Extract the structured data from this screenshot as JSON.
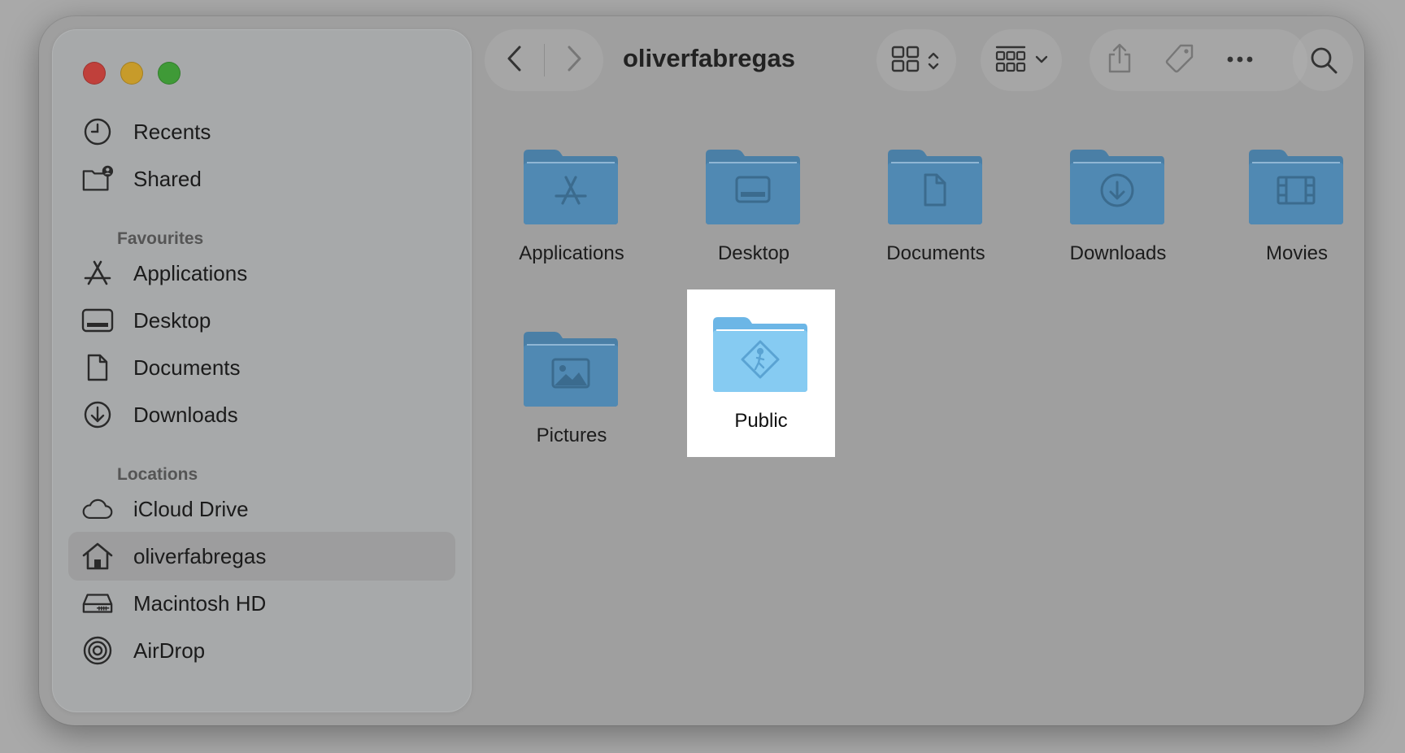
{
  "window": {
    "title": "oliverfabregas"
  },
  "sidebar": {
    "items_top": [
      {
        "label": "Recents",
        "icon": "clock-icon"
      },
      {
        "label": "Shared",
        "icon": "shared-folder-icon"
      }
    ],
    "favourites_heading": "Favourites",
    "favourites": [
      {
        "label": "Applications",
        "icon": "applications-icon"
      },
      {
        "label": "Desktop",
        "icon": "desktop-icon"
      },
      {
        "label": "Documents",
        "icon": "document-icon"
      },
      {
        "label": "Downloads",
        "icon": "download-icon"
      }
    ],
    "locations_heading": "Locations",
    "locations": [
      {
        "label": "iCloud Drive",
        "icon": "cloud-icon"
      },
      {
        "label": "oliverfabregas",
        "icon": "home-icon",
        "selected": true
      },
      {
        "label": "Macintosh HD",
        "icon": "drive-icon"
      },
      {
        "label": "AirDrop",
        "icon": "airdrop-icon"
      }
    ]
  },
  "files": [
    {
      "name": "Applications",
      "glyph": "applications-glyph"
    },
    {
      "name": "Desktop",
      "glyph": "desktop-glyph"
    },
    {
      "name": "Documents",
      "glyph": "document-glyph"
    },
    {
      "name": "Downloads",
      "glyph": "download-glyph"
    },
    {
      "name": "Movies",
      "glyph": "film-glyph"
    },
    {
      "name": "Pictures",
      "glyph": "picture-glyph"
    },
    {
      "name": "Public",
      "glyph": "public-glyph",
      "selected": true
    }
  ],
  "colors": {
    "folder_dark": "#4a7fa6",
    "folder_selected": "#7fc4ef",
    "selection_bg": "#ffffff"
  }
}
